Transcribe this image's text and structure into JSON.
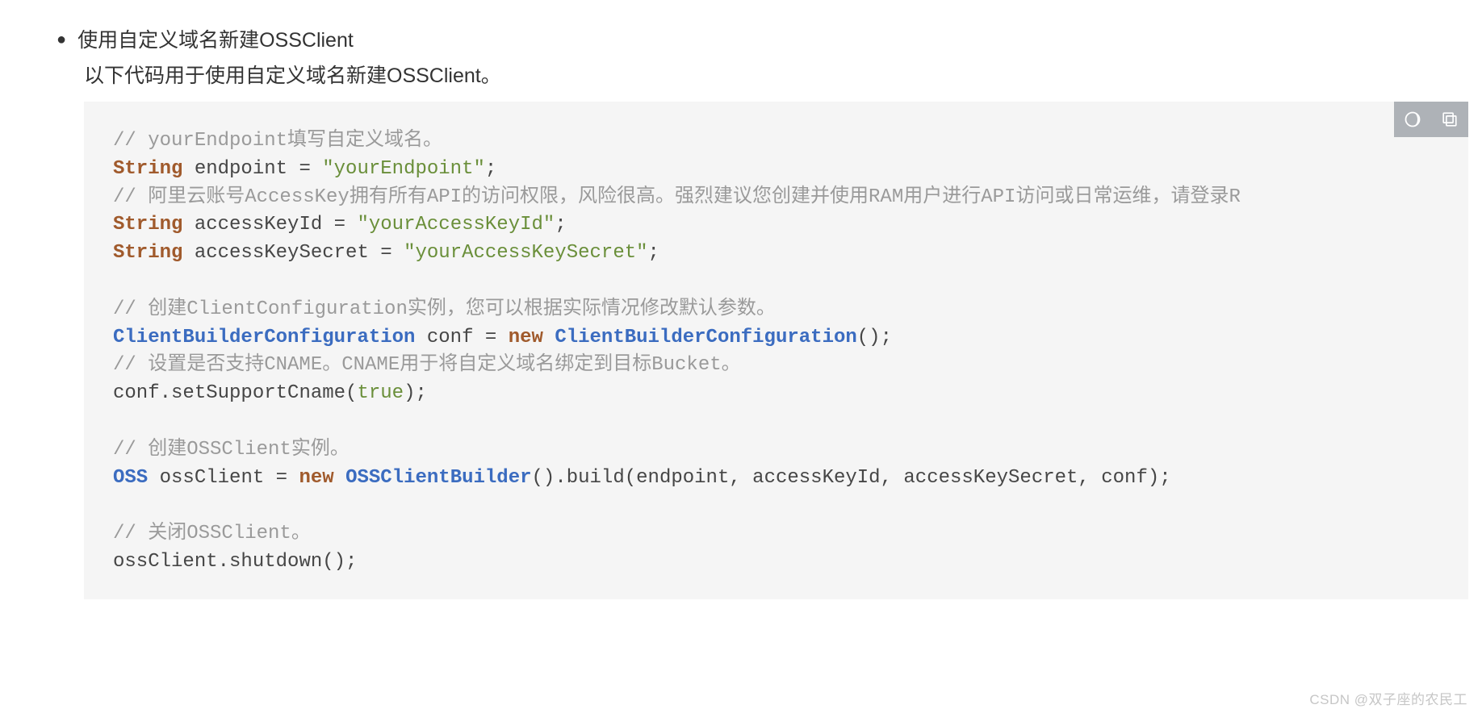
{
  "heading": "使用自定义域名新建OSSClient",
  "description": "以下代码用于使用自定义域名新建OSSClient。",
  "watermark": "CSDN @双子座的农民工",
  "code": {
    "l1_cmt": "// yourEndpoint填写自定义域名。",
    "l2_kw": "String",
    "l2_var": " endpoint = ",
    "l2_str": "\"yourEndpoint\"",
    "l2_end": ";",
    "l3_cmt": "// 阿里云账号AccessKey拥有所有API的访问权限，风险很高。强烈建议您创建并使用RAM用户进行API访问或日常运维，请登录R",
    "l4_kw": "String",
    "l4_var": " accessKeyId = ",
    "l4_str": "\"yourAccessKeyId\"",
    "l4_end": ";",
    "l5_kw": "String",
    "l5_var": " accessKeySecret = ",
    "l5_str": "\"yourAccessKeySecret\"",
    "l5_end": ";",
    "l7_cmt": "// 创建ClientConfiguration实例，您可以根据实际情况修改默认参数。",
    "l8_typ1": "ClientBuilderConfiguration",
    "l8_mid": " conf = ",
    "l8_kw": "new",
    "l8_sp": " ",
    "l8_typ2": "ClientBuilderConfiguration",
    "l8_end": "();",
    "l9_cmt": "// 设置是否支持CNAME。CNAME用于将自定义域名绑定到目标Bucket。",
    "l10_a": "conf.setSupportCname(",
    "l10_lit": "true",
    "l10_b": ");",
    "l12_cmt": "// 创建OSSClient实例。",
    "l13_typ": "OSS",
    "l13_a": " ossClient = ",
    "l13_kw": "new",
    "l13_sp": " ",
    "l13_typ2": "OSSClientBuilder",
    "l13_b": "().build(endpoint, accessKeyId, accessKeySecret, conf);",
    "l15_cmt": "// 关闭OSSClient。",
    "l16": "ossClient.shutdown();"
  }
}
